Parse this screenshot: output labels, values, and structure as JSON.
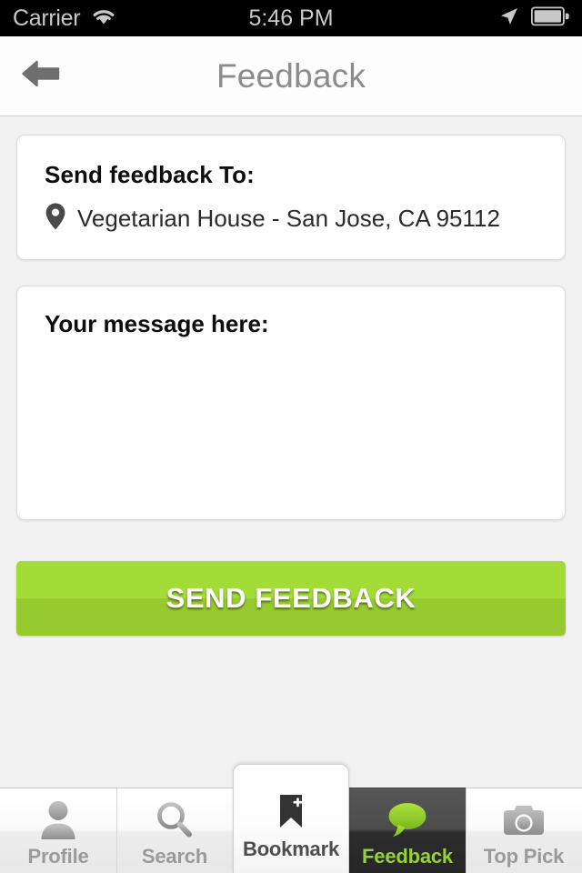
{
  "status_bar": {
    "carrier": "Carrier",
    "time": "5:46 PM",
    "wifi_icon": "wifi-icon",
    "location_icon": "location-arrow-icon",
    "battery_icon": "battery-full-icon"
  },
  "nav": {
    "title": "Feedback",
    "back_icon": "back-arrow-icon"
  },
  "recipient": {
    "title": "Send feedback To:",
    "pin_icon": "map-pin-icon",
    "name": "Vegetarian House - San Jose, CA 95112"
  },
  "message": {
    "label": "Your message here:",
    "value": "",
    "placeholder": ""
  },
  "actions": {
    "send_label": "SEND FEEDBACK"
  },
  "tabs": [
    {
      "id": "profile",
      "label": "Profile",
      "icon": "person-icon",
      "active": false
    },
    {
      "id": "search",
      "label": "Search",
      "icon": "magnifier-icon",
      "active": false
    },
    {
      "id": "bookmark",
      "label": "Bookmark",
      "icon": "bookmark-plus-icon",
      "active": false
    },
    {
      "id": "feedback",
      "label": "Feedback",
      "icon": "speech-bubble-icon",
      "active": true
    },
    {
      "id": "toppick",
      "label": "Top Pick",
      "icon": "camera-icon",
      "active": false
    }
  ],
  "colors": {
    "accent_green": "#a4dc37",
    "accent_green_dark": "#96ca2e",
    "active_tab_text": "#95d13b",
    "page_background": "#f2f2f2",
    "nav_title": "#8c8c8c"
  }
}
